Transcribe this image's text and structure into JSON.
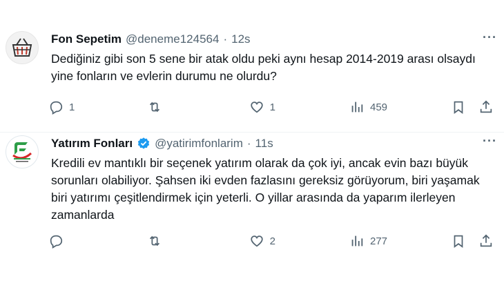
{
  "tweets": [
    {
      "author_name": "Fon Sepetim",
      "handle": "@deneme124564",
      "dot": "·",
      "time": "12s",
      "more": "···",
      "text": "Dediğiniz gibi son 5 sene bir atak oldu peki aynı hesap 2014-2019 arası olsaydı yine fonların ve evlerin durumu ne olurdu?",
      "replies": "1",
      "retweets": "",
      "likes": "1",
      "views": "459",
      "avatar_icon": "shopping-basket-icon",
      "verified": false
    },
    {
      "author_name": "Yatırım Fonları",
      "handle": "@yatirimfonlarim",
      "dot": "·",
      "time": "11s",
      "more": "···",
      "text": "Kredili ev mantıklı bir seçenek yatırım olarak da çok iyi, ancak evin bazı büyük sorunları olabiliyor. Şahsen iki evden fazlasını gereksiz görüyorum, biri yaşamak biri yatırımı çeşitlendirmek için yeterli. O yillar arasında da yaparım ilerleyen zamanlarda",
      "replies": "",
      "retweets": "",
      "likes": "2",
      "views": "277",
      "avatar_icon": "yatirim-fonlari-logo-icon",
      "verified": true
    }
  ],
  "colors": {
    "text": "#0f1419",
    "muted": "#536471",
    "verified": "#1d9bf0",
    "divider": "#eff3f4",
    "logo_green": "#2e9e48",
    "logo_red": "#d62828"
  }
}
